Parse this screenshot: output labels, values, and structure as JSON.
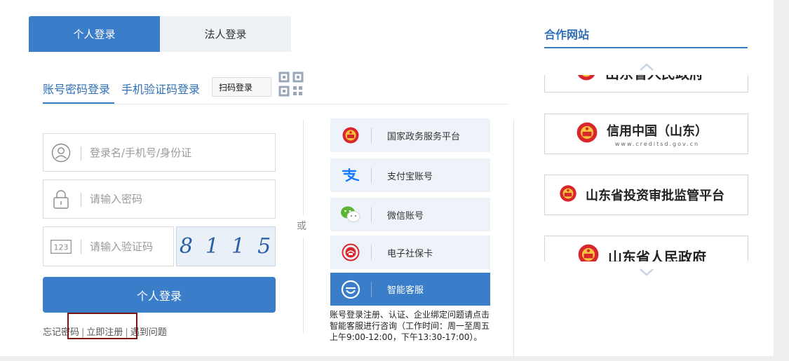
{
  "tabs": {
    "personal": "个人登录",
    "legal": "法人登录"
  },
  "login_methods": {
    "account": "账号密码登录",
    "sms": "手机验证码登录",
    "scan": "扫码登录"
  },
  "form": {
    "username_placeholder": "登录名/手机号/身份证",
    "password_placeholder": "请输入密码",
    "code_placeholder": "请输入验证码",
    "code_icon_text": "123",
    "captcha": [
      "8",
      "1",
      "1",
      "5"
    ],
    "submit_label": "个人登录"
  },
  "links": {
    "forgot": "忘记密码",
    "register": "立即注册",
    "help": "遇到问题",
    "sep": "|"
  },
  "or_text": "或",
  "alt_logins": [
    {
      "label": "国家政务服务平台",
      "icon": "national-emblem-icon"
    },
    {
      "label": "支付宝账号",
      "icon": "alipay-icon"
    },
    {
      "label": "微信账号",
      "icon": "wechat-icon"
    },
    {
      "label": "电子社保卡",
      "icon": "social-security-card-icon"
    },
    {
      "label": "智能客服",
      "icon": "smart-service-icon"
    }
  ],
  "notice": "账号登录注册、认证、企业绑定问题请点击智能客服进行咨询（工作时间：周一至周五上午9:00-12:00，下午13:30-17:00）。",
  "partners": {
    "title": "合作网站",
    "items": [
      {
        "name": "山东省人民政府"
      },
      {
        "name": "信用中国（山东）",
        "url": "www.creditsd.gov.cn"
      },
      {
        "name": "山东省投资审批监管平台"
      },
      {
        "name": "山东省人民政府"
      }
    ]
  },
  "colors": {
    "primary": "#3a7dc9",
    "link": "#2f6fb7",
    "highlight_border": "#7a1414"
  }
}
